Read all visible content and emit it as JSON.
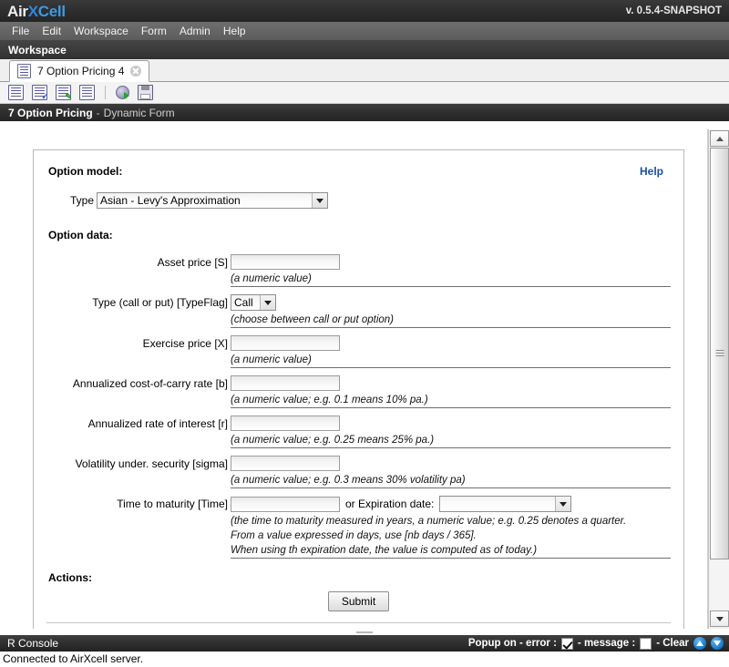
{
  "app": {
    "logo_air": "Air",
    "logo_x": "X",
    "logo_cell": "Cell",
    "version": "v. 0.5.4-SNAPSHOT"
  },
  "menu": {
    "items": [
      {
        "label": "File"
      },
      {
        "label": "Edit"
      },
      {
        "label": "Workspace"
      },
      {
        "label": "Form"
      },
      {
        "label": "Admin"
      },
      {
        "label": "Help"
      }
    ]
  },
  "breadcrumb": {
    "label": "Workspace"
  },
  "tabs": [
    {
      "label": "7 Option Pricing 4",
      "icon": "document-icon",
      "close": "close-icon"
    }
  ],
  "toolbar": {
    "buttons": [
      {
        "name": "new-form-icon"
      },
      {
        "name": "validate-form-icon"
      },
      {
        "name": "edit-form-icon"
      },
      {
        "name": "properties-icon"
      },
      {
        "name": "run-icon"
      },
      {
        "name": "save-icon"
      }
    ]
  },
  "form_header": {
    "name": "7 Option Pricing",
    "separator": "-",
    "subtitle": "Dynamic Form"
  },
  "form": {
    "model_section_title": "Option model:",
    "help_label": "Help",
    "type_label": "Type",
    "type_value": "Asian - Levy's Approximation",
    "data_section_title": "Option data:",
    "fields": [
      {
        "label": "Asset price [S]",
        "control": "text",
        "value": "",
        "hint": "(a numeric value)"
      },
      {
        "label": "Type (call or put) [TypeFlag]",
        "control": "combo",
        "value": "Call",
        "hint": "(choose between call or put option)"
      },
      {
        "label": "Exercise price [X]",
        "control": "text",
        "value": "",
        "hint": "(a numeric value)"
      },
      {
        "label": "Annualized cost-of-carry rate [b]",
        "control": "text",
        "value": "",
        "hint": "(a numeric value; e.g. 0.1 means 10% pa.)"
      },
      {
        "label": "Annualized rate of interest [r]",
        "control": "text",
        "value": "",
        "hint": "(a numeric value; e.g. 0.25 means 25% pa.)"
      },
      {
        "label": "Volatility under. security [sigma]",
        "control": "text",
        "value": "",
        "hint": "(a numeric value; e.g. 0.3 means 30% volatility pa)"
      },
      {
        "label": "Time to maturity [Time]",
        "control": "text-plus-date",
        "value": "",
        "or_text": "or Expiration date:",
        "date_value": "",
        "hint_line1": "(the time to maturity measured in years, a numeric value; e.g. 0.25 denotes a quarter.",
        "hint_line2": "From a value expressed in days, use [nb days / 365].",
        "hint_line3": "When using th expiration date, the value is computed as of today.)"
      }
    ],
    "actions_section_title": "Actions:",
    "submit_label": "Submit"
  },
  "console": {
    "title": "R Console",
    "popup_label": "Popup on - error :",
    "error_checked": true,
    "message_label": "- message :",
    "message_checked": false,
    "clear_label": "- Clear",
    "output": "Connected to AirXcell server."
  }
}
